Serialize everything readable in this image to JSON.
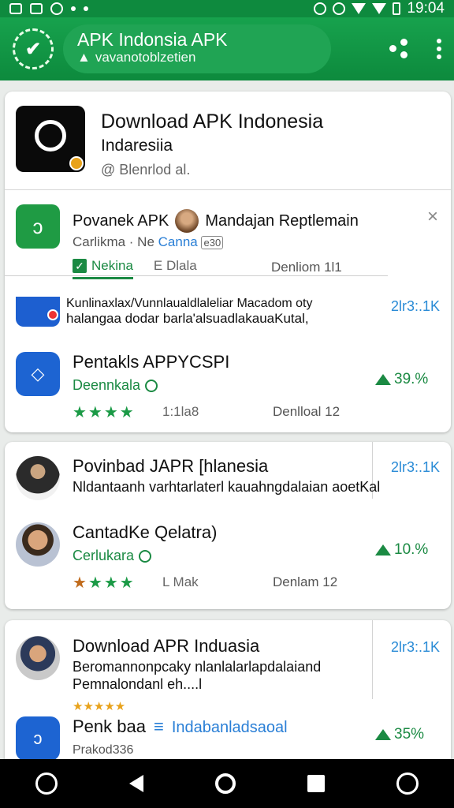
{
  "status": {
    "time": "19:04"
  },
  "appbar": {
    "title": "APK Indonsia APK",
    "subtitle": "vavanotoblzetien"
  },
  "hero": {
    "title": "Download APK Indonesia",
    "subtitle": "Indaresiia",
    "note": "@ Blenrlod al."
  },
  "popup": {
    "name": "Povanek APK",
    "name2": "Mandajan Reptlemain",
    "meta_left": "Carlikma · Ne",
    "meta_link": "Canna",
    "meta_tag": "e30",
    "tab_active": "Nekina",
    "tab2": "E Dlala",
    "stats": "Denliom 1l1",
    "close": "×"
  },
  "cut_row": {
    "line1": "Kunlinaxlax/Vunnlaualdlaleliar Macadom oty",
    "line2": "halangaa dodar barla'alsuadlakauaKutal,",
    "size": "2lr3:.1K"
  },
  "rows": [
    {
      "title": "Pentakls APPYCSPI",
      "dev": "Deennkala",
      "stars": "★★★★",
      "rating_count": "1:1la8",
      "downloads": "Denlloal 12",
      "pct": "39.%"
    },
    {
      "title": "Povinbad JAPR [hlanesia",
      "desc": "Nldantaanh varhtarlaterl kauahngdalaian aoetKal",
      "size": "2lr3:.1K"
    },
    {
      "title": "CantadKe Qelatra)",
      "dev": "Cerlukara",
      "stars": "★★★★",
      "rating_count": "L Mak",
      "downloads": "Denlam 12",
      "pct": "10.%"
    },
    {
      "title": "Download APR Induasia",
      "desc": "Beromannonpcaky nlanlalarlapdalaiand Pemnalondanl eh....l",
      "stars": "★★★★★",
      "size": "2lr3:.1K"
    },
    {
      "title": "Penk baa",
      "link": "Indabanladsaoal",
      "sub": "Prakod336",
      "pct": "35%"
    }
  ]
}
